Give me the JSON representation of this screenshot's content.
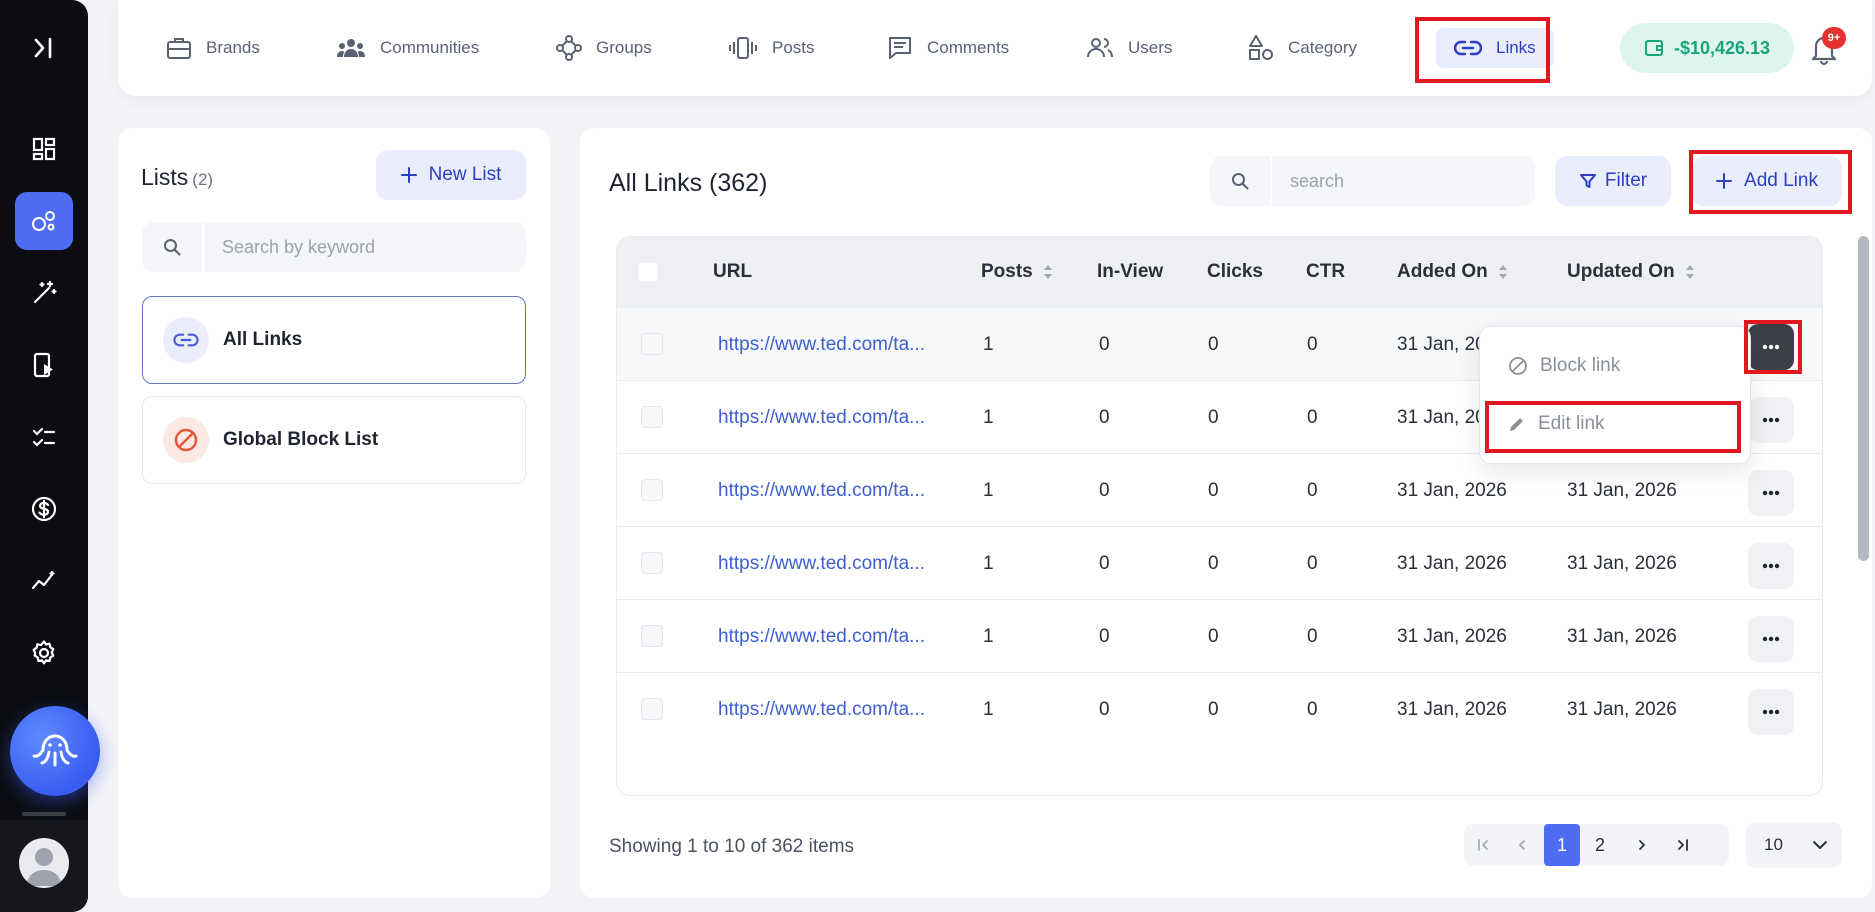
{
  "nav": {
    "items": [
      {
        "label": "Brands",
        "icon": "briefcase-icon"
      },
      {
        "label": "Communities",
        "icon": "people-group-icon"
      },
      {
        "label": "Groups",
        "icon": "nodes-icon"
      },
      {
        "label": "Posts",
        "icon": "vibrate-icon"
      },
      {
        "label": "Comments",
        "icon": "comment-icon"
      },
      {
        "label": "Users",
        "icon": "users-icon"
      },
      {
        "label": "Category",
        "icon": "shapes-icon"
      },
      {
        "label": "Links",
        "icon": "link-icon",
        "active": true
      }
    ],
    "balance": "-$10,426.13",
    "notifications_badge": "9+"
  },
  "sidebar": {
    "icons": [
      "expand-icon",
      "dashboard-icon",
      "integrations-icon",
      "magic-wand-icon",
      "mobile-play-icon",
      "checklist-icon",
      "dollar-icon",
      "analytics-icon",
      "settings-icon",
      "octopus-assistant-icon",
      "user-avatar-icon"
    ]
  },
  "lists_panel": {
    "title": "Lists",
    "count": "(2)",
    "new_list_label": "New List",
    "search_placeholder": "Search by keyword",
    "lists": [
      {
        "name": "All Links",
        "icon": "link-icon",
        "selected": true
      },
      {
        "name": "Global Block List",
        "icon": "block-icon"
      }
    ]
  },
  "links_panel": {
    "title": "All Links (362)",
    "search_placeholder": "search",
    "filter_label": "Filter",
    "add_label": "Add Link",
    "columns": [
      "URL",
      "Posts",
      "In-View",
      "Clicks",
      "CTR",
      "Added On",
      "Updated On"
    ],
    "rows": [
      {
        "url": "https://www.ted.com/ta...",
        "posts": "1",
        "in_view": "0",
        "clicks": "0",
        "ctr": "0",
        "added": "31 Jan, 20",
        "updated": ""
      },
      {
        "url": "https://www.ted.com/ta...",
        "posts": "1",
        "in_view": "0",
        "clicks": "0",
        "ctr": "0",
        "added": "31 Jan, 20",
        "updated": ""
      },
      {
        "url": "https://www.ted.com/ta...",
        "posts": "1",
        "in_view": "0",
        "clicks": "0",
        "ctr": "0",
        "added": "31 Jan, 2026",
        "updated": "31 Jan, 2026"
      },
      {
        "url": "https://www.ted.com/ta...",
        "posts": "1",
        "in_view": "0",
        "clicks": "0",
        "ctr": "0",
        "added": "31 Jan, 2026",
        "updated": "31 Jan, 2026"
      },
      {
        "url": "https://www.ted.com/ta...",
        "posts": "1",
        "in_view": "0",
        "clicks": "0",
        "ctr": "0",
        "added": "31 Jan, 2026",
        "updated": "31 Jan, 2026"
      },
      {
        "url": "https://www.ted.com/ta...",
        "posts": "1",
        "in_view": "0",
        "clicks": "0",
        "ctr": "0",
        "added": "31 Jan, 2026",
        "updated": "31 Jan, 2026"
      }
    ],
    "row_menu": {
      "block_label": "Block link",
      "edit_label": "Edit link"
    },
    "showing_text": "Showing 1 to 10 of 362 items",
    "pagination": {
      "current": "1",
      "next_page": "2"
    },
    "per_page": "10"
  },
  "colors": {
    "accent": "#4f6cf5",
    "highlight_box": "#e0191f",
    "balance_text": "#18a47a",
    "link_text": "#3d5fd1"
  }
}
